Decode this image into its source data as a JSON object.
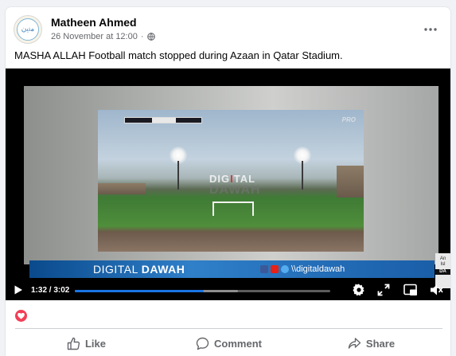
{
  "post": {
    "author": "Matheen Ahmed",
    "avatar_text": "ﻣﺗﻳﻥ",
    "date": "26 November at 12:00",
    "dot": "·",
    "caption": "MASHA ALLAH Football match stopped during Azaan in Qatar Stadium."
  },
  "video": {
    "channel_logo": "PRO",
    "watermark_top_a": "DIG",
    "watermark_top_b": "I",
    "watermark_top_c": "TAL",
    "watermark_bottom": "DAWAH",
    "banner_left_a": "DIGITAL",
    "banner_left_b": "DAWAH",
    "banner_right": "\\\\digitaldawah",
    "corner_logo_a": "An",
    "corner_logo_b": "Isl",
    "corner_logo_c": "DA",
    "time": "1:32 / 3:02",
    "progress_played": 0.505,
    "progress_buffered": 0.64
  },
  "icons": {
    "globe": "globe-icon",
    "more": "more-icon",
    "play": "play-icon",
    "settings": "settings-icon",
    "fullscreen": "expand-icon",
    "pip": "picture-in-picture-icon",
    "volume": "volume-icon",
    "heart": "heart-reaction-icon",
    "like": "thumbs-up-icon",
    "comment": "comment-icon",
    "share": "share-icon"
  },
  "actions": {
    "like": "Like",
    "comment": "Comment",
    "share": "Share"
  },
  "colors": {
    "accent": "#1b74e4",
    "heart": "#f33e58",
    "secondary_text": "#65676b"
  }
}
